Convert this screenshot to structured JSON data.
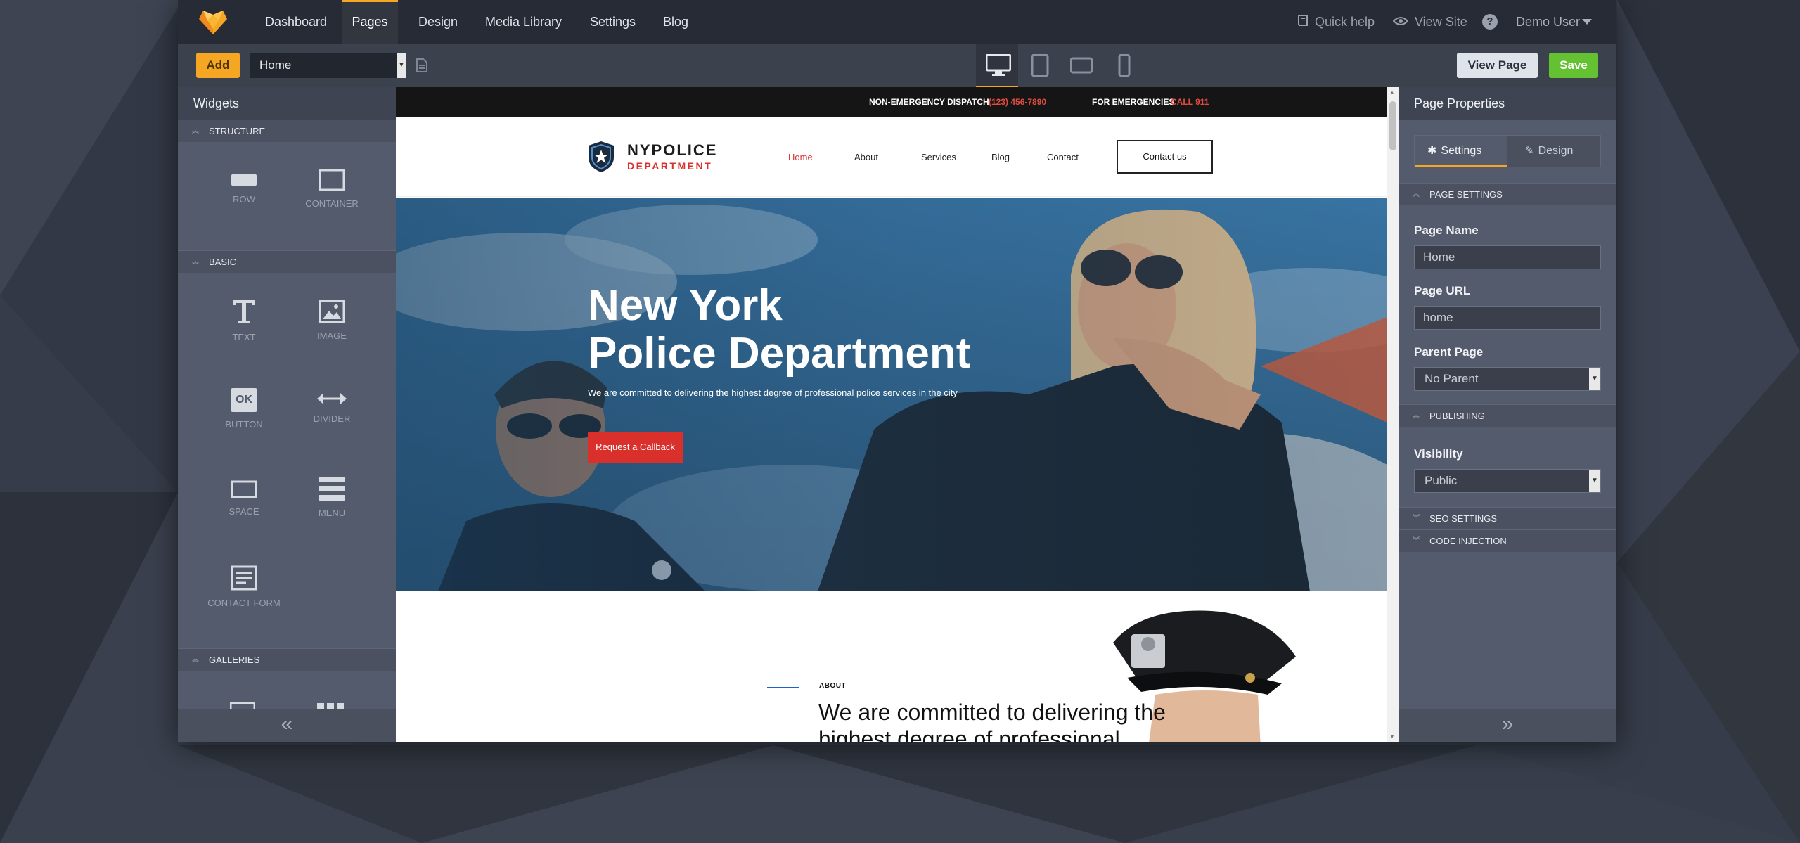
{
  "topnav": {
    "items": [
      "Dashboard",
      "Pages",
      "Design",
      "Media Library",
      "Settings",
      "Blog"
    ],
    "active": "Pages",
    "quick_help": "Quick help",
    "view_site": "View Site",
    "help_mark": "?",
    "user": "Demo User"
  },
  "toolbar": {
    "add_label": "Add",
    "page_select": "Home",
    "view_page_label": "View Page",
    "save_label": "Save",
    "devices": [
      "desktop-icon",
      "tablet-icon",
      "tablet-landscape-icon",
      "phone-icon"
    ],
    "active_device": "desktop-icon"
  },
  "widgets": {
    "title": "Widgets",
    "sections": {
      "structure": "STRUCTURE",
      "basic": "BASIC",
      "galleries": "GALLERIES"
    },
    "items": {
      "row": "ROW",
      "container": "CONTAINER",
      "text": "TEXT",
      "image": "IMAGE",
      "button": "BUTTON",
      "divider": "DIVIDER",
      "space": "SPACE",
      "menu": "MENU",
      "contact_form": "CONTACT FORM"
    },
    "button_icon_text": "OK",
    "collapse_glyph": "«"
  },
  "preview": {
    "topbar": {
      "dispatch_label": "NON-EMERGENCY DISPATCH",
      "dispatch_number": "(123) 456-7890",
      "emergency_label": "FOR EMERGENCIES",
      "emergency_number": "CALL 911"
    },
    "logo": {
      "line1": "NYPOLICE",
      "line2": "DEPARTMENT"
    },
    "nav": [
      "Home",
      "About",
      "Services",
      "Blog",
      "Contact"
    ],
    "contact_button": "Contact us",
    "hero": {
      "title_line1": "New York",
      "title_line2": "Police Department",
      "subtitle": "We are committed to delivering the highest degree of professional police services in the city",
      "button": "Request a Callback"
    },
    "about": {
      "kicker": "ABOUT",
      "title": "We are committed to delivering the highest degree of professional"
    }
  },
  "props": {
    "title": "Page Properties",
    "tabs": [
      "Settings",
      "Design"
    ],
    "active_tab": "Settings",
    "sections": {
      "page_settings": "PAGE SETTINGS",
      "publishing": "PUBLISHING",
      "seo": "SEO SETTINGS",
      "code": "CODE INJECTION"
    },
    "page_name_label": "Page Name",
    "page_name_value": "Home",
    "page_url_label": "Page URL",
    "page_url_value": "home",
    "parent_label": "Parent Page",
    "parent_value": "No Parent",
    "visibility_label": "Visibility",
    "visibility_value": "Public",
    "expand_glyph": "»"
  },
  "colors": {
    "accent": "#f5a623",
    "save": "#63c132",
    "site_red": "#d9302c",
    "site_blue": "#1e64c8"
  }
}
